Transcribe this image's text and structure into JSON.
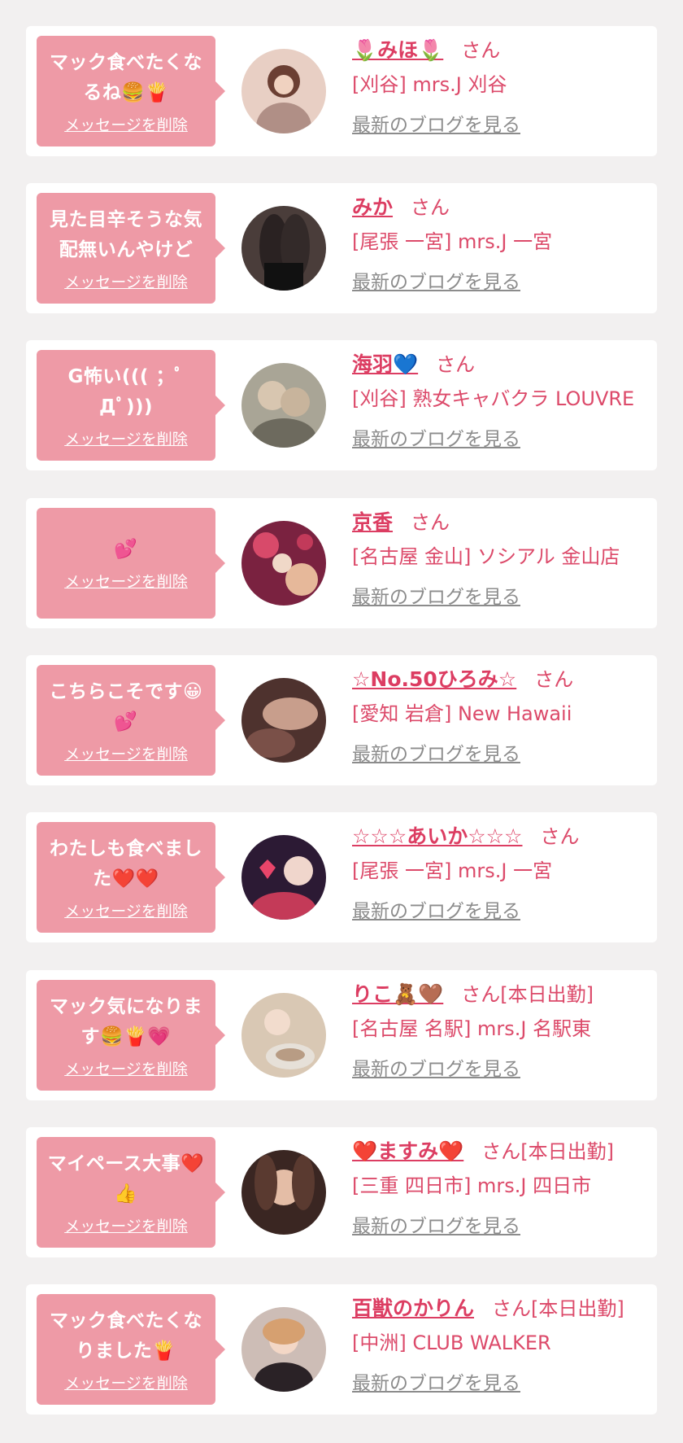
{
  "common": {
    "delete_label": "メッセージを削除",
    "blog_label": "最新のブログを見る"
  },
  "messages": [
    {
      "message": "マック食べたくなるね🍔🍟",
      "name": "🌷みほ🌷",
      "suffix": "さん",
      "shop": "[刈谷] mrs.J 刈谷",
      "avatar_color": "#d9b8a8"
    },
    {
      "message": "見た目辛そうな気配無いんやけど",
      "name": "みか",
      "suffix": "さん",
      "shop": "[尾張 一宮] mrs.J 一宮",
      "avatar_color": "#3a3230"
    },
    {
      "message": "G怖い((( ；ﾟДﾟ)))",
      "name": "海羽💙",
      "suffix": "さん",
      "shop": "[刈谷] 熟女キャバクラ LOUVRE",
      "avatar_color": "#9b9a8a"
    },
    {
      "message": "💕",
      "name": "京香",
      "suffix": "さん",
      "shop": "[名古屋 金山] ソシアル 金山店",
      "avatar_color": "#8a2e4a"
    },
    {
      "message": "こちらこそです😀💕",
      "name": "☆No.50ひろみ☆",
      "suffix": "さん",
      "shop": "[愛知 岩倉] New Hawaii",
      "avatar_color": "#5a3a36"
    },
    {
      "message": "わたしも食べました❤️❤️",
      "name": "☆☆☆あいか☆☆☆",
      "suffix": "さん",
      "shop": "[尾張 一宮] mrs.J 一宮",
      "avatar_color": "#3b2440"
    },
    {
      "message": "マック気になります🍔🍟💗",
      "name": "りこ🧸🤎",
      "suffix": "さん[本日出勤]",
      "shop": "[名古屋 名駅] mrs.J 名駅東",
      "avatar_color": "#cbb6a0"
    },
    {
      "message": "マイペース大事❤️👍",
      "name": "❤️ますみ❤️",
      "suffix": "さん[本日出勤]",
      "shop": "[三重 四日市] mrs.J 四日市",
      "avatar_color": "#4a3028"
    },
    {
      "message": "マック食べたくなりました🍟",
      "name": "百獣のかりん",
      "suffix": "さん[本日出勤]",
      "shop": "[中洲] CLUB WALKER",
      "avatar_color": "#b9a6a0"
    }
  ]
}
